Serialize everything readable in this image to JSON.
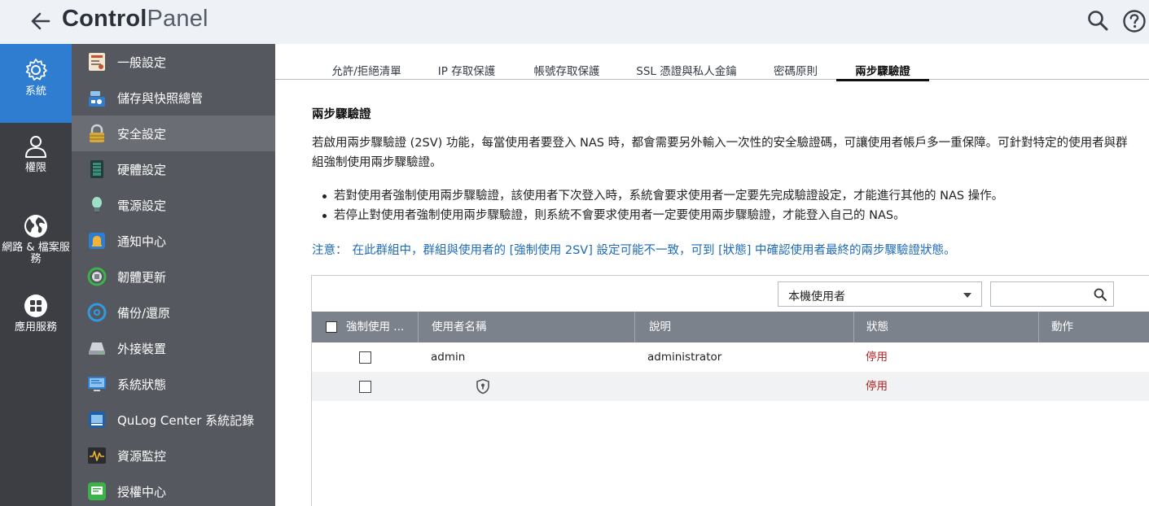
{
  "app": {
    "title_bold": "Control",
    "title_light": "Panel"
  },
  "rail": [
    {
      "label": "系統",
      "icon": "gear-icon",
      "active": true
    },
    {
      "label": "權限",
      "icon": "user-icon",
      "active": false
    },
    {
      "label": "網路 & 檔案服務",
      "icon": "globe-icon",
      "active": false
    },
    {
      "label": "應用服務",
      "icon": "apps-grid-icon",
      "active": false
    }
  ],
  "sidebar": [
    {
      "label": "一般設定",
      "icon": "general-settings-icon"
    },
    {
      "label": "儲存與快照總管",
      "icon": "storage-icon"
    },
    {
      "label": "安全設定",
      "icon": "lock-icon",
      "active": true
    },
    {
      "label": "硬體設定",
      "icon": "hardware-icon"
    },
    {
      "label": "電源設定",
      "icon": "power-bulb-icon"
    },
    {
      "label": "通知中心",
      "icon": "notification-icon"
    },
    {
      "label": "韌體更新",
      "icon": "firmware-update-icon"
    },
    {
      "label": "備份/還原",
      "icon": "backup-icon"
    },
    {
      "label": "外接裝置",
      "icon": "external-device-icon"
    },
    {
      "label": "系統狀態",
      "icon": "system-status-icon"
    },
    {
      "label": "QuLog Center 系統記錄",
      "icon": "qulog-icon"
    },
    {
      "label": "資源監控",
      "icon": "resource-monitor-icon"
    },
    {
      "label": "授權中心",
      "icon": "license-icon"
    }
  ],
  "tabs": [
    {
      "label": "允許/拒絕清單"
    },
    {
      "label": "IP 存取保護"
    },
    {
      "label": "帳號存取保護"
    },
    {
      "label": "SSL 憑證與私人金鑰"
    },
    {
      "label": "密碼原則"
    },
    {
      "label": "兩步驟驗證",
      "active": true
    }
  ],
  "content": {
    "title": "兩步驟驗證",
    "paragraph": "若啟用兩步驟驗證 (2SV) 功能，每當使用者要登入 NAS 時，都會需要另外輸入一次性的安全驗證碼，可讓使用者帳戶多一重保障。可針對特定的使用者與群組強制使用兩步驟驗證。",
    "bullets": [
      "若對使用者強制使用兩步驟驗證，該使用者下次登入時，系統會要求使用者一定要先完成驗證設定，才能進行其他的 NAS 操作。",
      "若停止對使用者強制使用兩步驟驗證，則系統不會要求使用者一定要使用兩步驟驗證，才能登入自己的 NAS。"
    ],
    "note_label": "注意：",
    "note_text": "在此群組中，群組與使用者的 [強制使用 2SV] 設定可能不一致，可到 [狀態] 中確認使用者最終的兩步驟驗證狀態。"
  },
  "table": {
    "filter_value": "本機使用者",
    "search_placeholder": "",
    "columns": [
      "強制使用 ...",
      "使用者名稱",
      "說明",
      "狀態",
      "動作"
    ],
    "rows": [
      {
        "enforce": false,
        "username": "admin",
        "description": "administrator",
        "status": "停用",
        "action": ""
      },
      {
        "enforce": false,
        "username": "",
        "description": "",
        "status": "停用",
        "action": "",
        "icon": "shield-icon"
      }
    ]
  }
}
